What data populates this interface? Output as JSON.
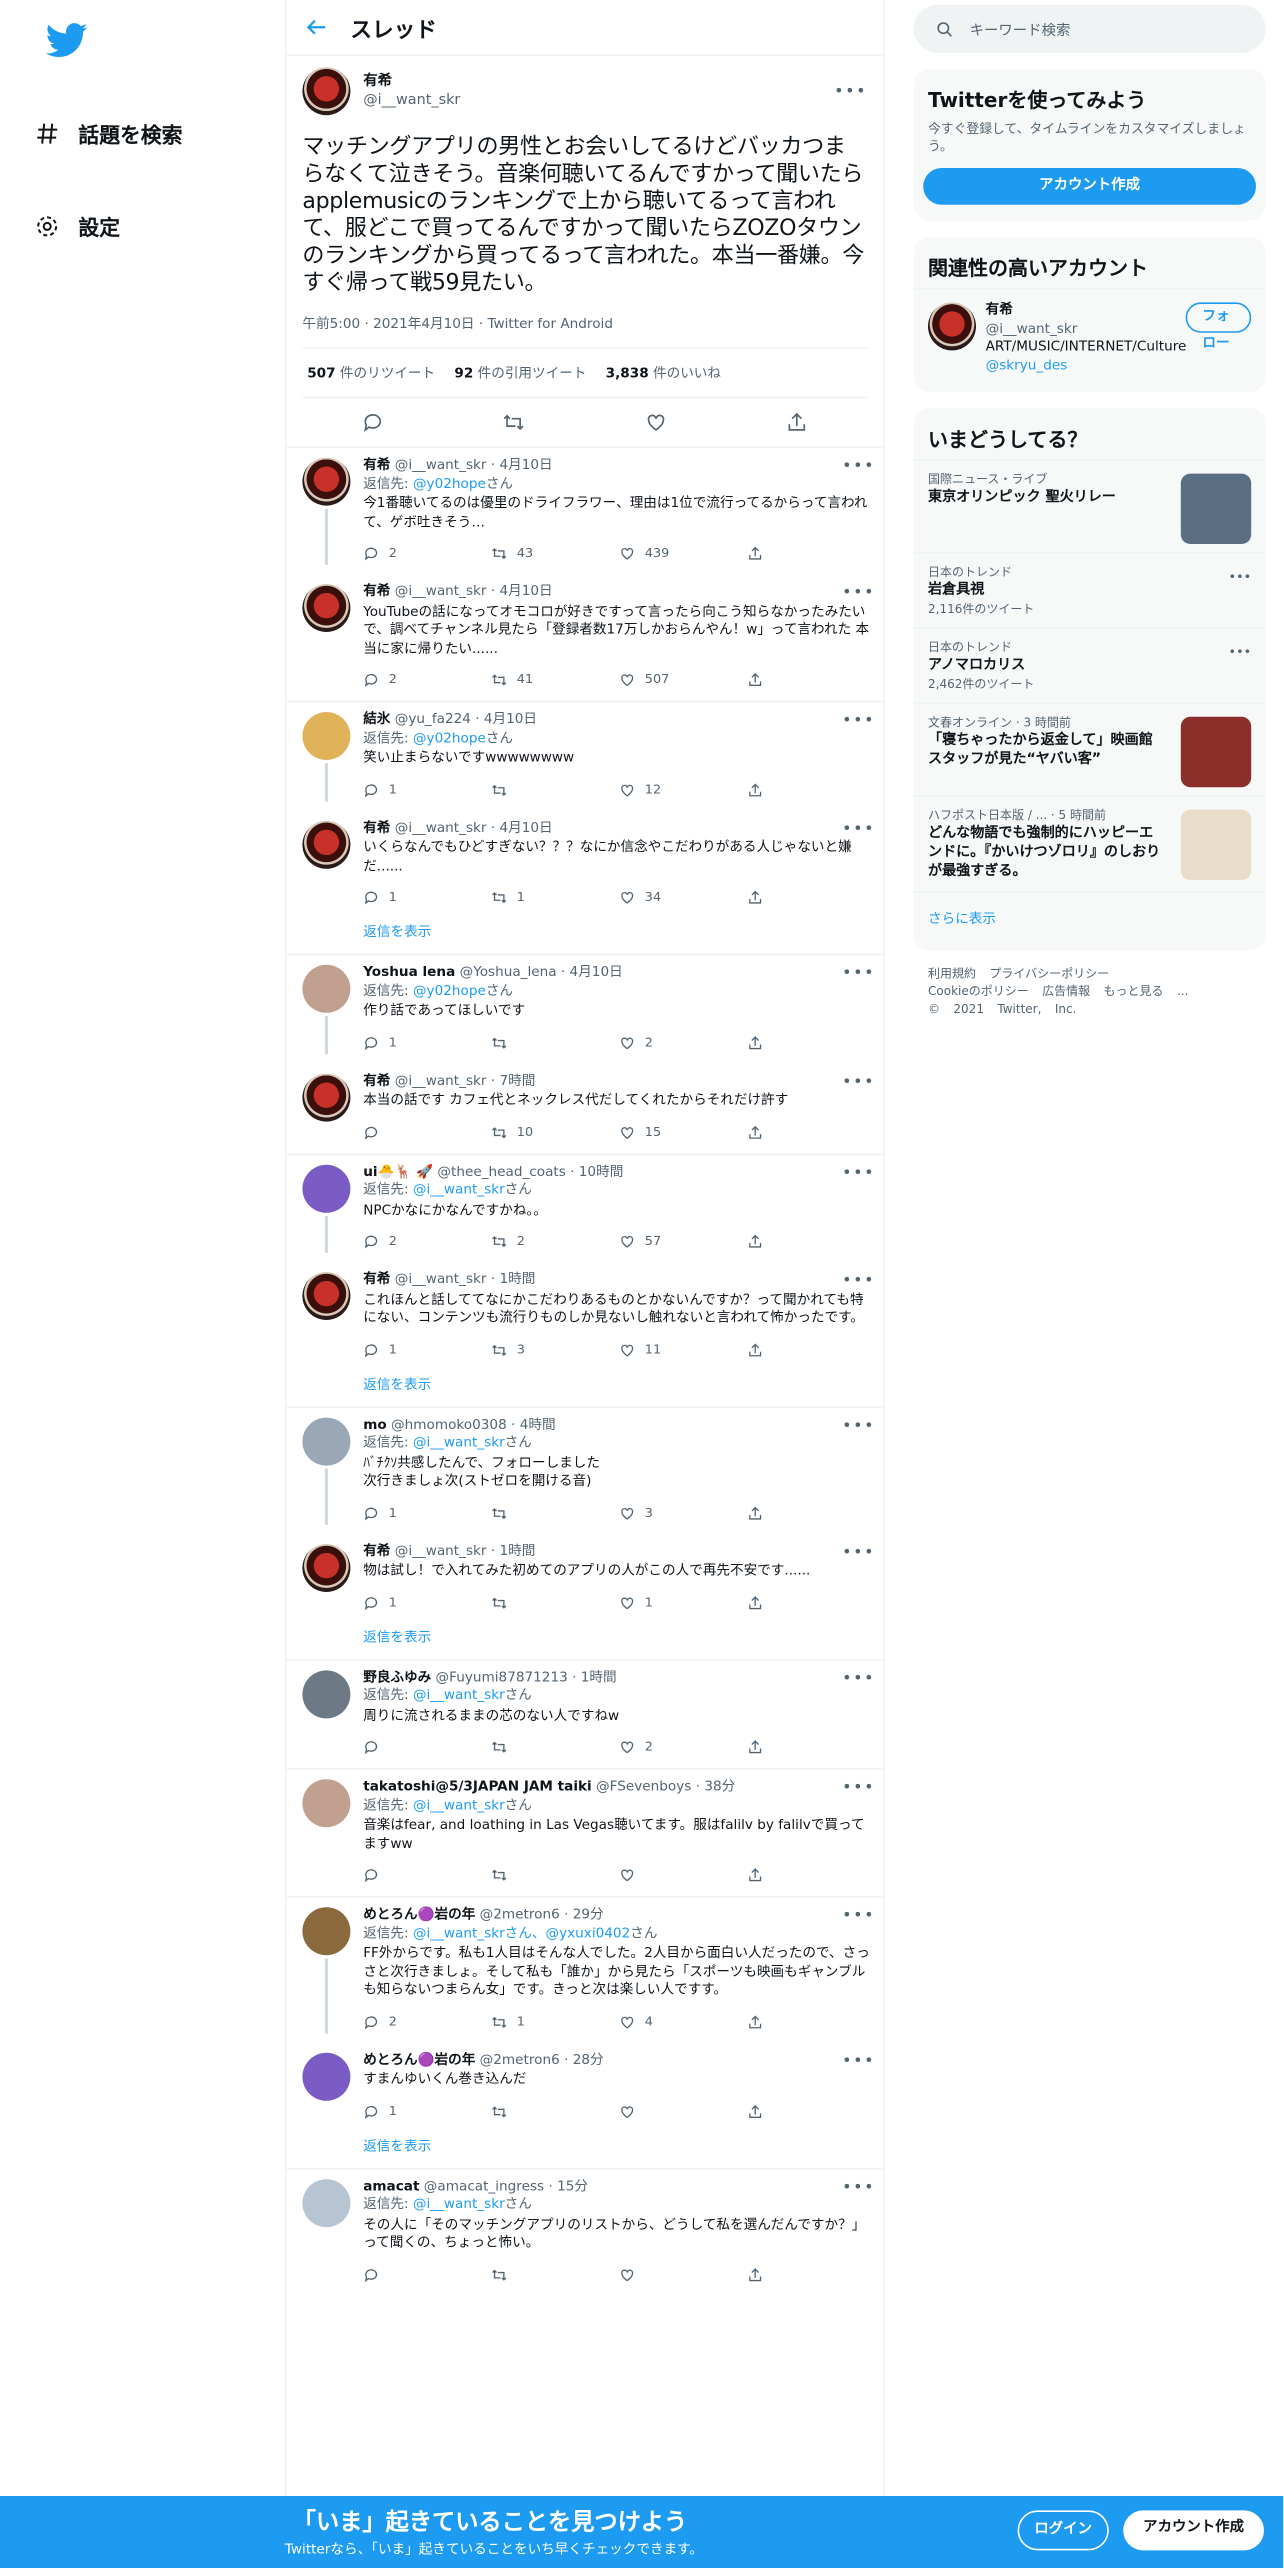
{
  "nav": {
    "explore": "話題を検索",
    "settings": "設定"
  },
  "header": {
    "title": "スレッド"
  },
  "main_tweet": {
    "name": "有希",
    "handle": "@i__want_skr",
    "text": "マッチングアプリの男性とお会いしてるけどバッカつまらなくて泣きそう。音楽何聴いてるんですかって聞いたらapplemusicのランキングで上から聴いてるって言われて、服どこで買ってるんですかって聞いたらZOZOタウンのランキングから買ってるって言われた。本当一番嫌。今すぐ帰って戦59見たい。",
    "meta": "午前5:00 · 2021年4月10日 · Twitter for Android",
    "retweets": "507",
    "retweets_label": "件のリツイート",
    "quotes": "92",
    "quotes_label": "件の引用ツイート",
    "likes": "3,838",
    "likes_label": "件のいいね"
  },
  "replies": [
    {
      "name": "有希",
      "handle": "@i__want_skr · 4月10日",
      "reply_prefix": "返信先: ",
      "reply_to": "@y02hope",
      "reply_suffix": "さん",
      "text": "今1番聴いてるのは優里のドライフラワー、理由は1位で流行ってるからって言われて、ゲボ吐きそう…",
      "replies": "2",
      "retweets": "43",
      "likes": "439",
      "line": true
    },
    {
      "name": "有希",
      "handle": "@i__want_skr · 4月10日",
      "reply_prefix": "",
      "reply_to": "",
      "reply_suffix": "",
      "text": "YouTubeの話になってオモコロが好きですって言ったら向こう知らなかったみたいで、調べてチャンネル見たら「登録者数17万しかおらんやん！w」って言われた 本当に家に帰りたい......",
      "replies": "2",
      "retweets": "41",
      "likes": "507",
      "line": false
    },
    {
      "name": "結氷",
      "handle": "@yu_fa224 · 4月10日",
      "reply_prefix": "返信先: ",
      "reply_to": "@y02hope",
      "reply_suffix": "さん",
      "text": "笑い止まらないですwwwwwwww",
      "replies": "1",
      "retweets": "",
      "likes": "12",
      "line": true
    },
    {
      "name": "有希",
      "handle": "@i__want_skr · 4月10日",
      "reply_prefix": "",
      "reply_to": "",
      "reply_suffix": "",
      "text": "いくらなんでもひどすぎない？？？なにか信念やこだわりがある人じゃないと嫌だ......",
      "replies": "1",
      "retweets": "1",
      "likes": "34",
      "line": false
    },
    {
      "name": "Yoshua lena",
      "handle": "@Yoshua_lena · 4月10日",
      "reply_prefix": "返信先: ",
      "reply_to": "@y02hope",
      "reply_suffix": "さん",
      "text": "作り話であってほしいです",
      "replies": "1",
      "retweets": "",
      "likes": "2",
      "line": true
    },
    {
      "name": "有希",
      "handle": "@i__want_skr · 7時間",
      "reply_prefix": "",
      "reply_to": "",
      "reply_suffix": "",
      "text": "本当の話です カフェ代とネックレス代だしてくれたからそれだけ許す",
      "replies": "",
      "retweets": "10",
      "likes": "15",
      "line": false
    },
    {
      "name": "ui🐣🦌 🚀",
      "handle": "@thee_head_coats · 10時間",
      "reply_prefix": "返信先: ",
      "reply_to": "@i__want_skr",
      "reply_suffix": "さん",
      "text": "NPCかなにかなんですかね。。",
      "replies": "2",
      "retweets": "2",
      "likes": "57",
      "line": true
    },
    {
      "name": "有希",
      "handle": "@i__want_skr · 1時間",
      "reply_prefix": "",
      "reply_to": "",
      "reply_suffix": "",
      "text": "これほんと話しててなにかこだわりあるものとかないんですか？って聞かれても特にない、コンテンツも流行りものしか見ないし触れないと言われて怖かったです。",
      "replies": "1",
      "retweets": "3",
      "likes": "11",
      "line": false
    },
    {
      "name": "mo",
      "handle": "@hmomoko0308 · 4時間",
      "reply_prefix": "返信先: ",
      "reply_to": "@i__want_skr",
      "reply_suffix": "さん",
      "text": "ﾊﾞﾁｸｿ共感したんで、フォローしました\n次行きましょ次(ストゼロを開ける音)",
      "replies": "1",
      "retweets": "",
      "likes": "3",
      "line": true
    },
    {
      "name": "有希",
      "handle": "@i__want_skr · 1時間",
      "reply_prefix": "",
      "reply_to": "",
      "reply_suffix": "",
      "text": "物は試し！で入れてみた初めてのアプリの人がこの人で再先不安です......",
      "replies": "1",
      "retweets": "",
      "likes": "1",
      "line": false
    },
    {
      "name": "野良ふゆみ",
      "handle": "@Fuyumi87871213 · 1時間",
      "reply_prefix": "返信先: ",
      "reply_to": "@i__want_skr",
      "reply_suffix": "さん",
      "text": "周りに流されるままの芯のない人ですねw",
      "replies": "",
      "retweets": "",
      "likes": "2",
      "line": false
    },
    {
      "name": "takatoshi@5/3JAPAN JAM taiki",
      "handle": "@FSevenboys · 38分",
      "reply_prefix": "返信先: ",
      "reply_to": "@i__want_skr",
      "reply_suffix": "さん",
      "text": "音楽はfear, and loathing in Las Vegas聴いてます。服はfalilv by falilvで買ってますww",
      "replies": "",
      "retweets": "",
      "likes": "",
      "line": false
    },
    {
      "name": "めとろん🟣岩の年",
      "handle": "@2metron6 · 29分",
      "reply_prefix": "返信先: ",
      "reply_to": "@i__want_skrさん、@yxuxi0402",
      "reply_suffix": "さん",
      "text": "FF外からです。私も1人目はそんな人でした。2人目から面白い人だったので、さっさと次行きましょ。そして私も「誰か」から見たら「スポーツも映画もギャンブルも知らないつまらん女」です。きっと次は楽しい人ですす。",
      "replies": "2",
      "retweets": "1",
      "likes": "4",
      "line": true
    },
    {
      "name": "めとろん🟣岩の年",
      "handle": "@2metron6 · 28分",
      "reply_prefix": "",
      "reply_to": "",
      "reply_suffix": "",
      "text": "すまんゆいくん巻き込んだ",
      "replies": "1",
      "retweets": "",
      "likes": "",
      "line": false
    },
    {
      "name": "amacat",
      "handle": "@amacat_ingress · 15分",
      "reply_prefix": "返信先: ",
      "reply_to": "@i__want_skr",
      "reply_suffix": "さん",
      "text": "その人に「そのマッチングアプリのリストから、どうして私を選んだんですか？」って聞くの、ちょっと怖い。",
      "replies": "",
      "retweets": "",
      "likes": "",
      "line": false
    }
  ],
  "show_replies": "返信を表示",
  "search": {
    "placeholder": "キーワード検索"
  },
  "signup": {
    "title": "Twitterを使ってみよう",
    "desc": "今すぐ登録して、タイムラインをカスタマイズしましょう。",
    "button": "アカウント作成"
  },
  "related": {
    "title": "関連性の高いアカウント",
    "name": "有希",
    "handle": "@i__want_skr",
    "bio": "ART/MUSIC/INTERNET/Culture",
    "link": "@skryu_des",
    "follow": "フォロー"
  },
  "trends": {
    "title": "いまどうしてる？",
    "items": [
      {
        "cat": "国際ニュース・ライブ",
        "title": "東京オリンピック 聖火リレー",
        "count": ""
      },
      {
        "cat": "日本のトレンド",
        "title": "岩倉具視",
        "count": "2,116件のツイート"
      },
      {
        "cat": "日本のトレンド",
        "title": "アノマロカリス",
        "count": "2,462件のツイート"
      },
      {
        "cat": "文春オンライン · 3 時間前",
        "title": "「寝ちゃったから返金して」映画館スタッフが見た“ヤバい客”",
        "count": ""
      },
      {
        "cat": "ハフポスト日本版 / ... · 5 時間前",
        "title": "どんな物語でも強制的にハッピーエンドに。『かいけつゾロリ』のしおりが最強すぎる。",
        "count": ""
      }
    ],
    "more": "さらに表示"
  },
  "footer": {
    "line1": "利用規約 プライバシーポリシー",
    "line2": "Cookieのポリシー 広告情報 もっと見る ...",
    "line3": "© 2021 Twitter, Inc."
  },
  "bottom": {
    "headline": "「いま」起きていることを見つけよう",
    "sub": "Twitterなら、「いま」起きていることをいち早くチェックできます。",
    "login": "ログイン",
    "signup": "アカウント作成"
  },
  "colors": {
    "accent": "#1d9bf0"
  }
}
